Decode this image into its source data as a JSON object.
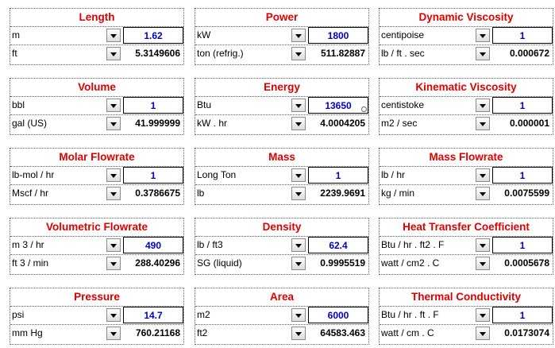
{
  "cards": [
    {
      "title": "Length",
      "from_unit": "m",
      "to_unit": "ft",
      "input_value": "1.62",
      "output_value": "5.3149606"
    },
    {
      "title": "Power",
      "from_unit": "kW",
      "to_unit": "ton  (refrig.)",
      "input_value": "1800",
      "output_value": "511.82887"
    },
    {
      "title": "Dynamic Viscosity",
      "from_unit": "centipoise",
      "to_unit": "lb / ft . sec",
      "input_value": "1",
      "output_value": "0.000672"
    },
    {
      "title": "Volume",
      "from_unit": "bbl",
      "to_unit": "gal  (US)",
      "input_value": "1",
      "output_value": "41.999999"
    },
    {
      "title": "Energy",
      "from_unit": "Btu",
      "to_unit": "kW .  hr",
      "input_value": "13650",
      "output_value": "4.0004205"
    },
    {
      "title": "Kinematic Viscosity",
      "from_unit": "centistoke",
      "to_unit": "m2 / sec",
      "input_value": "1",
      "output_value": "0.000001"
    },
    {
      "title": "Molar Flowrate",
      "from_unit": "lb-mol / hr",
      "to_unit": "Mscf / hr",
      "input_value": "1",
      "output_value": "0.3786675"
    },
    {
      "title": "Mass",
      "from_unit": "Long Ton",
      "to_unit": "lb",
      "input_value": "1",
      "output_value": "2239.9691"
    },
    {
      "title": "Mass Flowrate",
      "from_unit": "lb / hr",
      "to_unit": "kg / min",
      "input_value": "1",
      "output_value": "0.0075599"
    },
    {
      "title": "Volumetric Flowrate",
      "from_unit": "m 3 / hr",
      "to_unit": "ft 3 / min",
      "input_value": "490",
      "output_value": "288.40296"
    },
    {
      "title": "Density",
      "from_unit": "lb / ft3",
      "to_unit": "SG  (liquid)",
      "input_value": "62.4",
      "output_value": "0.9995519"
    },
    {
      "title": "Heat Transfer Coefficient",
      "from_unit": "Btu / hr . ft2 . F",
      "to_unit": "watt / cm2 . C",
      "input_value": "1",
      "output_value": "0.0005678"
    },
    {
      "title": "Pressure",
      "from_unit": "psi",
      "to_unit": "mm Hg",
      "input_value": "14.7",
      "output_value": "760.21168"
    },
    {
      "title": "Area",
      "from_unit": "m2",
      "to_unit": "ft2",
      "input_value": "6000",
      "output_value": "64583.463"
    },
    {
      "title": "Thermal Conductivity",
      "from_unit": "Btu / hr . ft . F",
      "to_unit": "watt / cm . C",
      "input_value": "1",
      "output_value": "0.0173074"
    }
  ],
  "colors": {
    "title": "#e00000",
    "input_value": "#0000cc",
    "output_value": "#000000"
  },
  "icons": {
    "dropdown": "chevron-down-icon"
  }
}
